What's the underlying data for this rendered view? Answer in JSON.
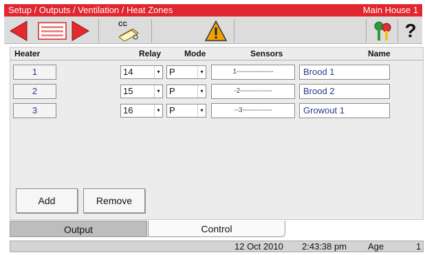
{
  "title": {
    "breadcrumb": "Setup / Outputs / Ventilation / Heat Zones",
    "location": "Main House 1"
  },
  "toolbar": {
    "back_icon": "left-arrow-icon",
    "list_icon": "list-card-icon",
    "forward_icon": "right-arrow-icon",
    "cc_label": "CC",
    "alarm_icon": "warning-triangle-icon",
    "keys_icon": "keys-icon",
    "help_label": "?"
  },
  "table": {
    "headers": {
      "heater": "Heater",
      "relay": "Relay",
      "mode": "Mode",
      "sensors": "Sensors",
      "name": "Name"
    },
    "rows": [
      {
        "heater": "1",
        "relay": "14",
        "mode": "P",
        "sensors": "1----------------",
        "name": "Brood 1"
      },
      {
        "heater": "2",
        "relay": "15",
        "mode": "P",
        "sensors": "-2--------------",
        "name": "Brood 2"
      },
      {
        "heater": "3",
        "relay": "16",
        "mode": "P",
        "sensors": "--3-------------",
        "name": "Growout 1"
      }
    ]
  },
  "actions": {
    "add": "Add",
    "remove": "Remove"
  },
  "tabs": {
    "output": "Output",
    "control": "Control"
  },
  "status": {
    "date": "12 Oct 2010",
    "time": "2:43:38 pm",
    "age_label": "Age",
    "age_value": "1"
  },
  "colors": {
    "title_red": "#e0262f",
    "arrow_red": "#e32a2a",
    "alert_orange": "#f2a007",
    "value_blue": "#2a3a8a"
  }
}
